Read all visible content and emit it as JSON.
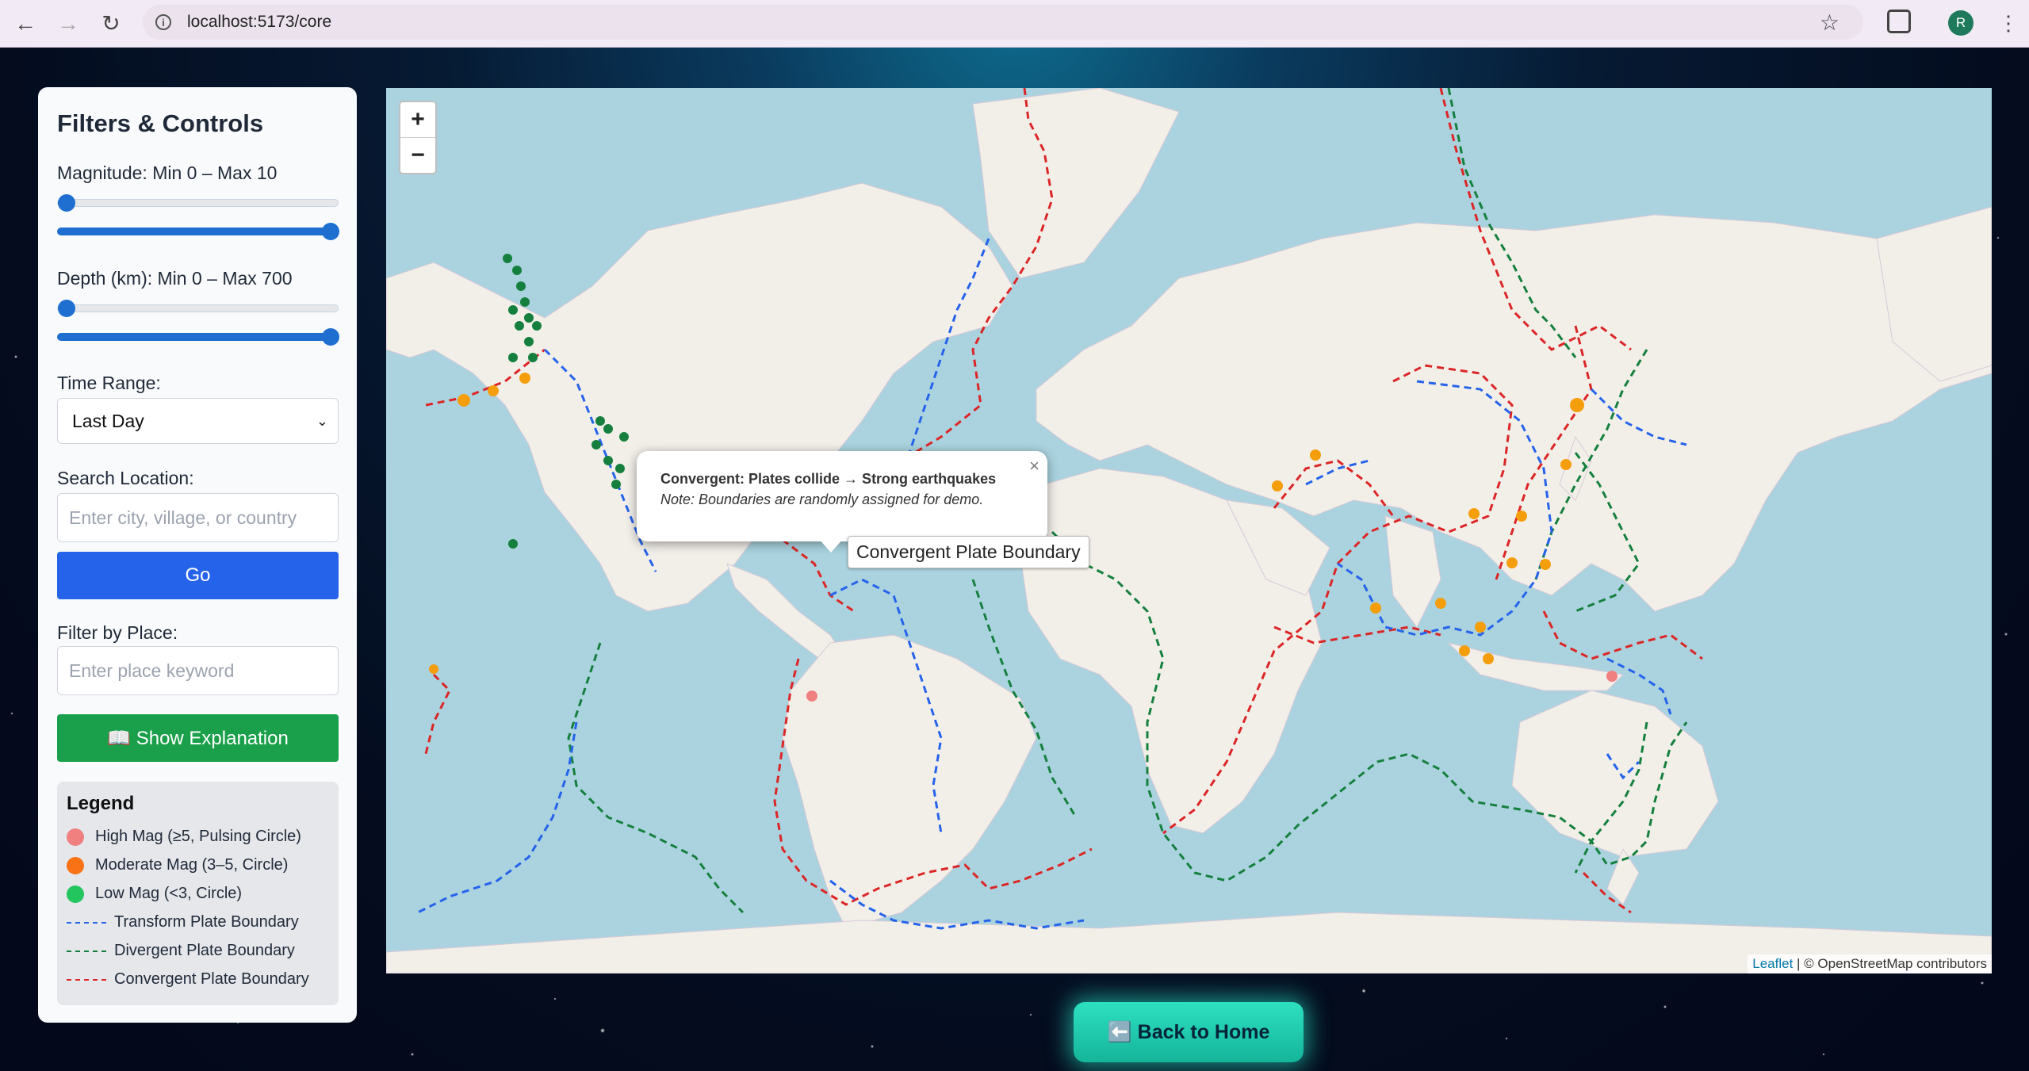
{
  "browser": {
    "url": "localhost:5173/core",
    "back_icon": "arrow-left",
    "forward_icon": "arrow-right",
    "reload_icon": "reload",
    "avatar_letter": "R"
  },
  "panel": {
    "title": "Filters & Controls",
    "magnitude_label": "Magnitude: Min 0 – Max 10",
    "magnitude_min": 0,
    "magnitude_max": 10,
    "depth_label": "Depth (km): Min 0 – Max 700",
    "depth_min": 0,
    "depth_max": 700,
    "time_label": "Time Range:",
    "time_value": "Last Day",
    "search_label": "Search Location:",
    "search_placeholder": "Enter city, village, or country",
    "go_label": "Go",
    "place_label": "Filter by Place:",
    "place_placeholder": "Enter place keyword",
    "explain_label": "📖 Show Explanation"
  },
  "legend": {
    "title": "Legend",
    "items": [
      {
        "label": "High Mag (≥5, Pulsing Circle)",
        "color": "#f08080"
      },
      {
        "label": "Moderate Mag (3–5, Circle)",
        "color": "#f97316"
      },
      {
        "label": "Low Mag (<3, Circle)",
        "color": "#22c55e"
      },
      {
        "label": "Transform Plate Boundary",
        "color": "#2563eb"
      },
      {
        "label": "Divergent Plate Boundary",
        "color": "#15803d"
      },
      {
        "label": "Convergent Plate Boundary",
        "color": "#dc2626"
      }
    ]
  },
  "map": {
    "zoom_in": "+",
    "zoom_out": "−",
    "attribution_link": "Leaflet",
    "attribution_text": "| © OpenStreetMap contributors",
    "popup_title": "Convergent: Plates collide → Strong earthquakes",
    "popup_note": "Note: Boundaries are randomly assigned for demo.",
    "popup_close": "×",
    "tooltip": "Convergent Plate Boundary"
  },
  "home_button": "⬅️ Back to Home"
}
